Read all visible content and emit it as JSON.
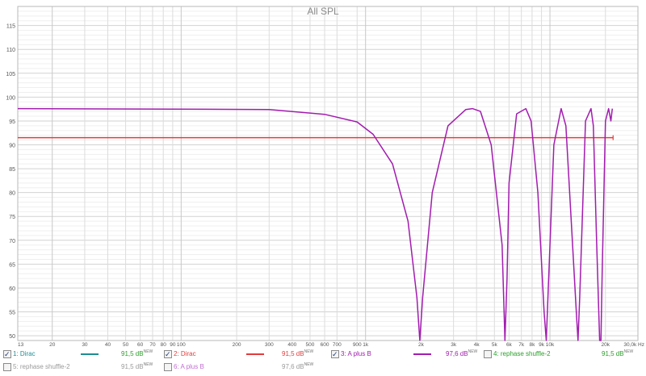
{
  "chart_data": {
    "type": "line",
    "title": "All SPL",
    "x_unit": "Hz",
    "x_scale": "log",
    "xlim": [
      13,
      30000
    ],
    "ylim": [
      49,
      119
    ],
    "x_tick_labels": [
      "13",
      "20",
      "30",
      "40",
      "50",
      "60",
      "70",
      "80",
      "90",
      "100",
      "200",
      "300",
      "400",
      "500",
      "600",
      "700",
      "900",
      "1k",
      "2k",
      "3k",
      "4k",
      "5k",
      "6k",
      "7k",
      "8k",
      "9k",
      "10k",
      "20k",
      "30,0k Hz"
    ],
    "x_tick_values": [
      13,
      20,
      30,
      40,
      50,
      60,
      70,
      80,
      90,
      100,
      200,
      300,
      400,
      500,
      600,
      700,
      900,
      1000,
      2000,
      3000,
      4000,
      5000,
      6000,
      7000,
      8000,
      9000,
      10000,
      20000,
      30000
    ],
    "y_ticks": [
      50,
      55,
      60,
      65,
      70,
      75,
      80,
      85,
      90,
      95,
      100,
      105,
      110,
      115
    ],
    "grid": true,
    "series": [
      {
        "name": "2: Dirac",
        "color": "#e33b3b",
        "x": [
          13,
          22000
        ],
        "y": [
          91.5,
          91.5
        ]
      },
      {
        "name": "3: A plus B",
        "color": "#a21caf",
        "x": [
          13,
          300,
          600,
          900,
          1100,
          1400,
          1700,
          1900,
          1970,
          2040,
          2300,
          2800,
          3500,
          3800,
          4200,
          4800,
          5500,
          5700,
          5850,
          6000,
          6600,
          7400,
          7900,
          8600,
          9300,
          9550,
          9800,
          10500,
          11500,
          12200,
          13000,
          13900,
          14200,
          14500,
          15600,
          16700,
          17200,
          17900,
          18600,
          18900,
          19200,
          20000,
          20800,
          21400,
          21800
        ],
        "y": [
          97.6,
          97.4,
          96.4,
          94.8,
          92.2,
          86,
          74,
          58,
          49,
          58,
          80,
          94,
          97.4,
          97.6,
          97,
          90,
          69,
          49,
          62,
          82,
          96.5,
          97.6,
          95,
          80,
          55,
          49,
          60,
          90,
          97.6,
          94,
          75,
          55,
          49,
          58,
          95,
          97.6,
          94,
          70,
          49,
          49,
          63,
          95,
          97.6,
          95,
          97.6
        ]
      }
    ]
  },
  "legend": {
    "items": [
      {
        "label": "1: Dirac",
        "checked": true,
        "color": "#1e8c93",
        "label_color": "#1e8c93",
        "value": "91,5 dB",
        "badge": "NEW"
      },
      {
        "label": "2: Dirac",
        "checked": true,
        "color": "#e33b3b",
        "label_color": "#e33b3b",
        "value": "91,5 dB",
        "badge": "NEW"
      },
      {
        "label": "3: A plus B",
        "checked": true,
        "color": "#a21caf",
        "label_color": "#a21caf",
        "value": "97,6 dB",
        "badge": "NEW"
      },
      {
        "label": "4: rephase shuffle-2",
        "checked": false,
        "color": "#2aa02a",
        "label_color": "#2aa02a",
        "value": "91,5 dB",
        "badge": "NEW"
      },
      {
        "label": "5: rephase shuffle-2",
        "checked": false,
        "color": "#9a9a9a",
        "label_color": "#9a9a9a",
        "value": "91,5 dB",
        "badge": "NEW"
      },
      {
        "label": "6: A plus B",
        "checked": false,
        "color": "#c06fd0",
        "label_color": "#c06fd0",
        "value": "97,6 dB",
        "badge": "NEW"
      }
    ]
  }
}
